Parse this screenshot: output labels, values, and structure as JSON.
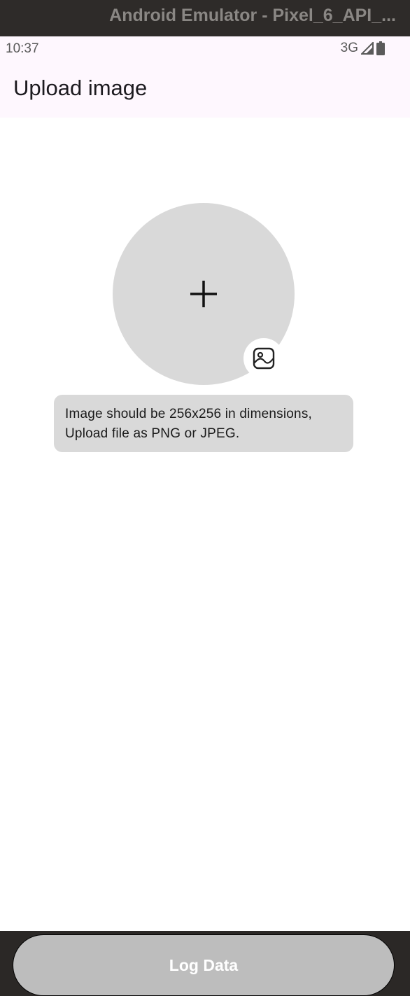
{
  "window": {
    "title": "Android Emulator - Pixel_6_API_..."
  },
  "status_bar": {
    "time": "10:37",
    "network": "3G"
  },
  "app_bar": {
    "title": "Upload image"
  },
  "picker": {
    "plus_icon": "plus-icon",
    "gallery_icon": "image-gallery-icon",
    "hint_lines": [
      "Image should be 256x256 in dimensions,",
      "Upload file as PNG or JPEG."
    ]
  },
  "footer": {
    "log_button_label": "Log Data"
  },
  "colors": {
    "appbar_bg": "#fef7fe",
    "placeholder_grey": "#d9d9d9",
    "button_disabled": "#bdbdbd"
  }
}
